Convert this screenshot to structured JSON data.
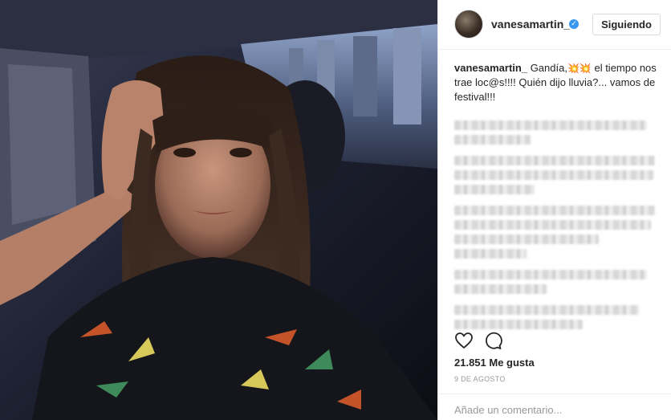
{
  "post": {
    "username": "vanesamartin_",
    "verified_glyph": "✓",
    "follow_button": "Siguiendo",
    "caption_user": "vanesamartin_",
    "caption_part1": "Gandía,",
    "caption_emoji": "💥💥",
    "caption_part2": "el tiempo nos trae loc@s!!!! Quién dijo lluvia?... vamos de festival!!!",
    "likes": "21.851 Me gusta",
    "date": "9 DE AGOSTO",
    "comment_placeholder": "Añade un comentario..."
  },
  "icons": {
    "like": "heart-icon",
    "comment": "comment-bubble-icon",
    "verified": "verified-badge-icon"
  },
  "colors": {
    "verified_blue": "#3897f0",
    "text": "#262626",
    "muted": "#999999",
    "border": "#dbdbdb"
  }
}
